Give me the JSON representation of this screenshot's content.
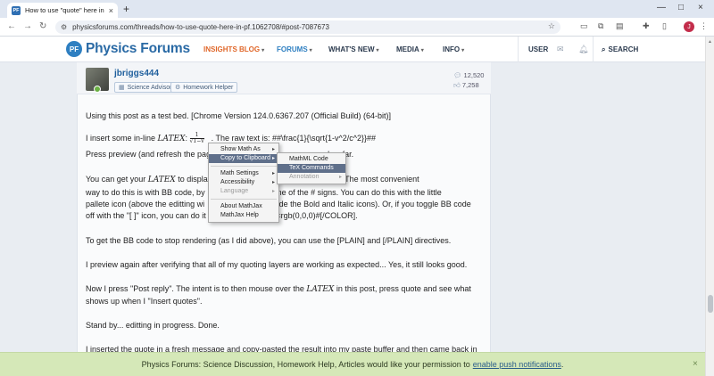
{
  "browser": {
    "tab_title": "How to use \"quote\" here in PF",
    "tab_favicon": "PF",
    "tab_close": "×",
    "new_tab": "+",
    "url": "physicsforums.com/threads/how-to-use-quote-here-in-pf.1062708/#post-7087673",
    "win_min": "—",
    "win_max": "□",
    "win_close": "×",
    "profile_initial": "J"
  },
  "site": {
    "logo_text": "Physics Forums",
    "nav": {
      "insights": "INSIGHTS BLOG",
      "forums": "FORUMS",
      "whats_new": "WHAT'S NEW",
      "media": "MEDIA",
      "info": "INFO"
    },
    "user": "USER",
    "search": "SEARCH"
  },
  "post": {
    "username": "jbriggs444",
    "badges": [
      "Science Advisor",
      "Homework Helper"
    ],
    "messages": "12,520",
    "reactions": "7,258",
    "p1": "Using this post as a test bed. [Chrome Version 124.0.6367.207 (Official Build) (64-bit)]",
    "p2_pre": "I insert some in-line",
    "latex_word": "LATEX",
    "p2_colon": ":",
    "frac_num": "1",
    "frac_den": "√1−v",
    "p2_post": ". The raw text is: ##\\frac{1}{\\sqrt{1-v^2/c^2}}##",
    "p3_pre": "Press preview (and refresh the pag",
    "p3_post": "ood so far.",
    "p4_l1_pre": "You can get your",
    "p4_l1_post": "to display",
    "p4_l1_end": "## introducer. The most convenient",
    "p4_l2_pre": "way to do this is with BB code, by",
    "p4_l2_post": "of one of the # signs. You can do this with the little",
    "p4_l3_pre": "pallete icon (above the editting wi",
    "p4_l3_post": "eside the Bold and Italic icons). Or, if you toggle BB code",
    "p4_l4_pre": "off with the \"[ ]\" icon, you can do it",
    "p4_l4_post": "[COLOR=rgb(0,0,0)#[/COLOR].",
    "p5": "To get the BB code to stop rendering (as I did above), you can use the [PLAIN] and [/PLAIN] directives.",
    "p6": "I preview again after verifying that all of my quoting layers are working as expected... Yes, it still looks good.",
    "p7_pre": "Now I press \"Post reply\". The intent is to then mouse over the",
    "p7_post": "in this post, press quote and see what",
    "p7_l2": "shows up when I \"Insert quotes\".",
    "p8": "Stand by... editting in progress. Done.",
    "p9": "I inserted the quote in a fresh message and copy-pasted the result into my paste buffer and then came back in"
  },
  "mathjax_menu": {
    "items": [
      "Show Math As",
      "Copy to Clipboard",
      "Math Settings",
      "Accessibility",
      "Language",
      "About MathJax",
      "MathJax Help"
    ]
  },
  "clipboard_submenu": {
    "items": [
      "MathML Code",
      "TeX Commands",
      "Annotation"
    ]
  },
  "notification": {
    "text": "Physics Forums: Science Discussion, Homework Help, Articles would like your permission to",
    "link": "enable push notifications",
    "period": ".",
    "close": "×"
  }
}
